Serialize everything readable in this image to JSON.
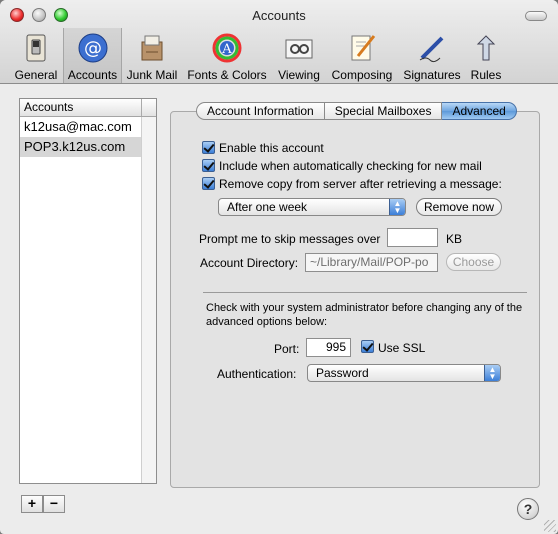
{
  "window": {
    "title": "Accounts"
  },
  "toolbar": {
    "items": [
      {
        "label": "General",
        "icon": "switch-icon"
      },
      {
        "label": "Accounts",
        "icon": "at-icon"
      },
      {
        "label": "Junk Mail",
        "icon": "junk-mail-icon"
      },
      {
        "label": "Fonts & Colors",
        "icon": "fonts-colors-icon"
      },
      {
        "label": "Viewing",
        "icon": "viewing-icon"
      },
      {
        "label": "Composing",
        "icon": "composing-icon"
      },
      {
        "label": "Signatures",
        "icon": "signatures-icon"
      },
      {
        "label": "Rules",
        "icon": "rules-icon"
      }
    ],
    "selected": "Accounts"
  },
  "accounts": {
    "header": "Accounts",
    "items": [
      "k12usa@mac.com",
      "POP3.k12us.com"
    ],
    "selected": "POP3.k12us.com",
    "add_label": "+",
    "remove_label": "−"
  },
  "tabs": {
    "items": [
      "Account Information",
      "Special Mailboxes",
      "Advanced"
    ],
    "active": "Advanced"
  },
  "advanced": {
    "enable_label": "Enable this account",
    "include_label": "Include when automatically checking for new mail",
    "remove_copy_label": "Remove copy from server after retrieving a message:",
    "remove_when_value": "After one week",
    "remove_now_label": "Remove now",
    "prompt_label": "Prompt me to skip messages over",
    "prompt_value": "",
    "kb_label": "KB",
    "account_dir_label": "Account Directory:",
    "account_dir_value": "~/Library/Mail/POP-po",
    "choose_label": "Choose",
    "note": "Check with your system administrator before changing any of the advanced options below:",
    "port_label": "Port:",
    "port_value": "995",
    "use_ssl_label": "Use SSL",
    "auth_label": "Authentication:",
    "auth_value": "Password"
  },
  "help_label": "?",
  "colors": {
    "accent": "#5c99d9",
    "selection": "#d6d6d6"
  }
}
